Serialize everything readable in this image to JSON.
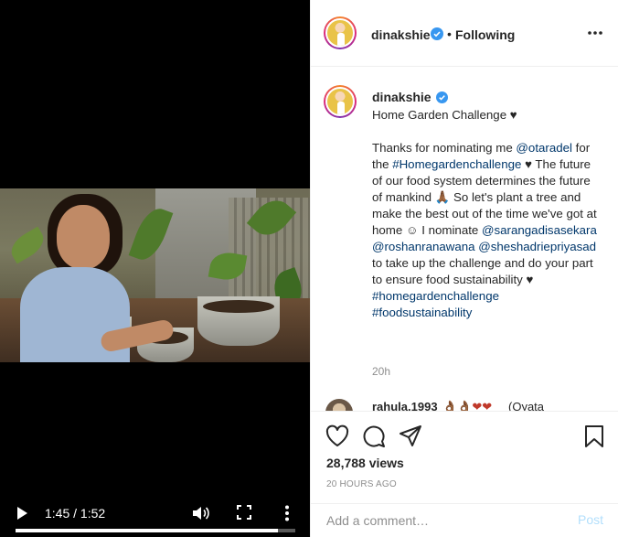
{
  "video": {
    "current_time": "1:45",
    "duration": "1:52",
    "time_display": "1:45 / 1:52",
    "progress": 0.9375
  },
  "header": {
    "username": "dinakshie",
    "separator": "•",
    "follow_status": "Following"
  },
  "caption": {
    "username": "dinakshie",
    "title": "Home Garden Challenge ♥",
    "body_parts": [
      {
        "t": "Thanks for nominating me ",
        "link": false
      },
      {
        "t": "@otaradel",
        "link": true
      },
      {
        "t": " for the ",
        "link": false
      },
      {
        "t": "#Homegardenchallenge",
        "link": true
      },
      {
        "t": " ♥ The future of our food system determines the future of mankind 🙏🏾 So let's plant a tree and make the best out of the time we've got at home ☺ I nominate ",
        "link": false
      },
      {
        "t": "@sarangadisasekara",
        "link": true
      },
      {
        "t": " ",
        "link": false
      },
      {
        "t": "@roshanranawana",
        "link": true
      },
      {
        "t": " ",
        "link": false
      },
      {
        "t": "@sheshadriepriyasad",
        "link": true
      },
      {
        "t": " to take up the challenge and do your part to ensure food sustainability ♥ ",
        "link": false
      },
      {
        "t": "#homegardenchallenge",
        "link": true
      },
      {
        "t": " ",
        "link": false
      },
      {
        "t": "#foodsustainability",
        "link": true
      }
    ],
    "time_ago": "20h"
  },
  "next_comment": {
    "username": "rahula.1993",
    "emojis": "👌🏾👌🏾❤❤",
    "text": "(Oyata"
  },
  "stats": {
    "views": "28,788 views",
    "date": "20 HOURS AGO"
  },
  "comment_box": {
    "placeholder": "Add a comment…",
    "post_label": "Post"
  },
  "colors": {
    "link": "#00376b",
    "verified": "#3897f0",
    "post_disabled": "#b2dffc"
  },
  "icons": [
    "play-icon",
    "volume-icon",
    "fullscreen-icon",
    "more-vertical-icon",
    "verified-icon",
    "more-horizontal-icon",
    "heart-icon",
    "comment-icon",
    "share-icon",
    "bookmark-icon"
  ]
}
